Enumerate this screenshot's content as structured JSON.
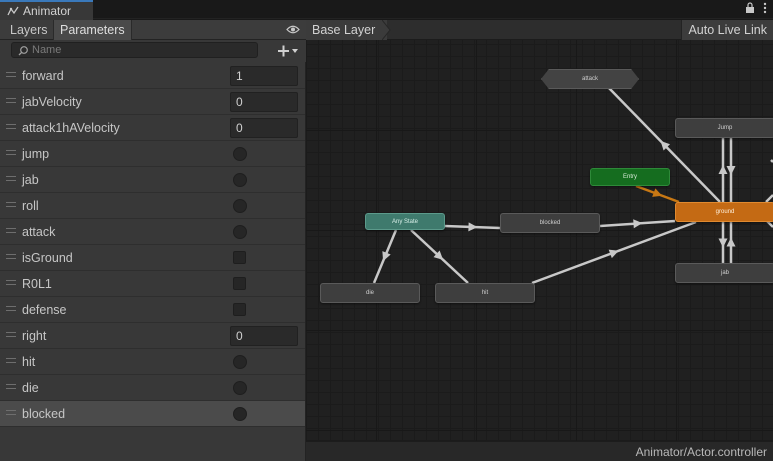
{
  "window": {
    "tab_title": "Animator"
  },
  "left_panel": {
    "tabs": {
      "layers": "Layers",
      "parameters": "Parameters"
    },
    "search_placeholder": "Name",
    "parameters": [
      {
        "name": "forward",
        "kind": "float",
        "value": "1"
      },
      {
        "name": "jabVelocity",
        "kind": "float",
        "value": "0"
      },
      {
        "name": "attack1hAVelocity",
        "kind": "float",
        "value": "0"
      },
      {
        "name": "jump",
        "kind": "trigger",
        "value": ""
      },
      {
        "name": "jab",
        "kind": "trigger",
        "value": ""
      },
      {
        "name": "roll",
        "kind": "trigger",
        "value": ""
      },
      {
        "name": "attack",
        "kind": "trigger",
        "value": ""
      },
      {
        "name": "isGround",
        "kind": "bool",
        "value": ""
      },
      {
        "name": "R0L1",
        "kind": "bool",
        "value": ""
      },
      {
        "name": "defense",
        "kind": "bool",
        "value": ""
      },
      {
        "name": "right",
        "kind": "float",
        "value": "0"
      },
      {
        "name": "hit",
        "kind": "trigger",
        "value": ""
      },
      {
        "name": "die",
        "kind": "trigger",
        "value": ""
      },
      {
        "name": "blocked",
        "kind": "trigger",
        "value": "",
        "selected": true
      }
    ]
  },
  "graph": {
    "breadcrumb": "Base Layer",
    "auto_live_link": "Auto Live Link",
    "footer_path": "Animator/Actor.controller",
    "states": {
      "attack": "attack",
      "jump": "Jump",
      "entry": "Entry",
      "ground": "ground",
      "any_state": "Any State",
      "blocked": "blocked",
      "jab": "jab",
      "die": "die",
      "hit": "hit"
    },
    "colors": {
      "default_state": "#3e3e3e",
      "entry_state": "#156d1f",
      "any_state": "#3f7a6d",
      "default_layer_state": "#c46a14",
      "transition": "#c8c8c8",
      "entry_transition": "#c87814"
    }
  }
}
